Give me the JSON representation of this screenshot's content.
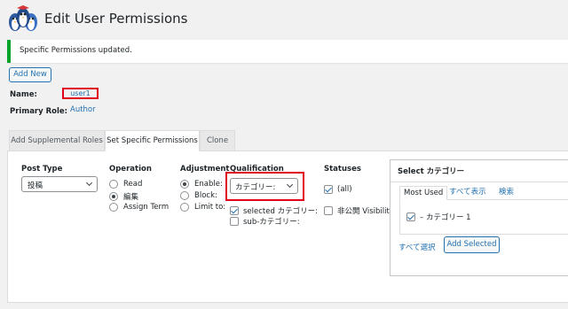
{
  "header": {
    "title": "Edit User Permissions"
  },
  "notice": {
    "text": "Specific Permissions updated."
  },
  "toolbar": {
    "add_new_label": "Add New"
  },
  "user": {
    "name_label": "Name:",
    "name_value": "user1",
    "role_label": "Primary Role:",
    "role_value": "Author"
  },
  "tabs": [
    {
      "label": "Add Supplemental Roles"
    },
    {
      "label": "Set Specific Permissions"
    },
    {
      "label": "Clone"
    }
  ],
  "form": {
    "post_type": {
      "heading": "Post Type",
      "value": "投稿"
    },
    "operation": {
      "heading": "Operation",
      "options": [
        "Read",
        "編集",
        "Assign Term"
      ],
      "selected": "編集"
    },
    "adjustment": {
      "heading": "Adjustment",
      "options": [
        "Enable:",
        "Block:",
        "Limit to:"
      ],
      "selected": "Enable:"
    },
    "qualification": {
      "heading": "Qualification",
      "value": "カテゴリー:",
      "checkboxes": [
        {
          "label": "selected カテゴリー:",
          "checked": true
        },
        {
          "label": "sub-カテゴリー:",
          "checked": false
        }
      ]
    },
    "statuses": {
      "heading": "Statuses",
      "items": [
        {
          "label": "(all)",
          "checked": true
        },
        {
          "label": "非公開 Visibility",
          "checked": false
        }
      ]
    }
  },
  "category_box": {
    "title": "Select カテゴリー",
    "tabs": [
      "Most Used",
      "すべて表示",
      "検索"
    ],
    "items": [
      {
        "label": "– カテゴリー 1",
        "checked": true
      }
    ],
    "select_all_label": "すべて選択",
    "add_selected_label": "Add Selected"
  },
  "colors": {
    "accent": "#2271b1",
    "success": "#00a32a",
    "highlight_box": "#e0001b"
  }
}
